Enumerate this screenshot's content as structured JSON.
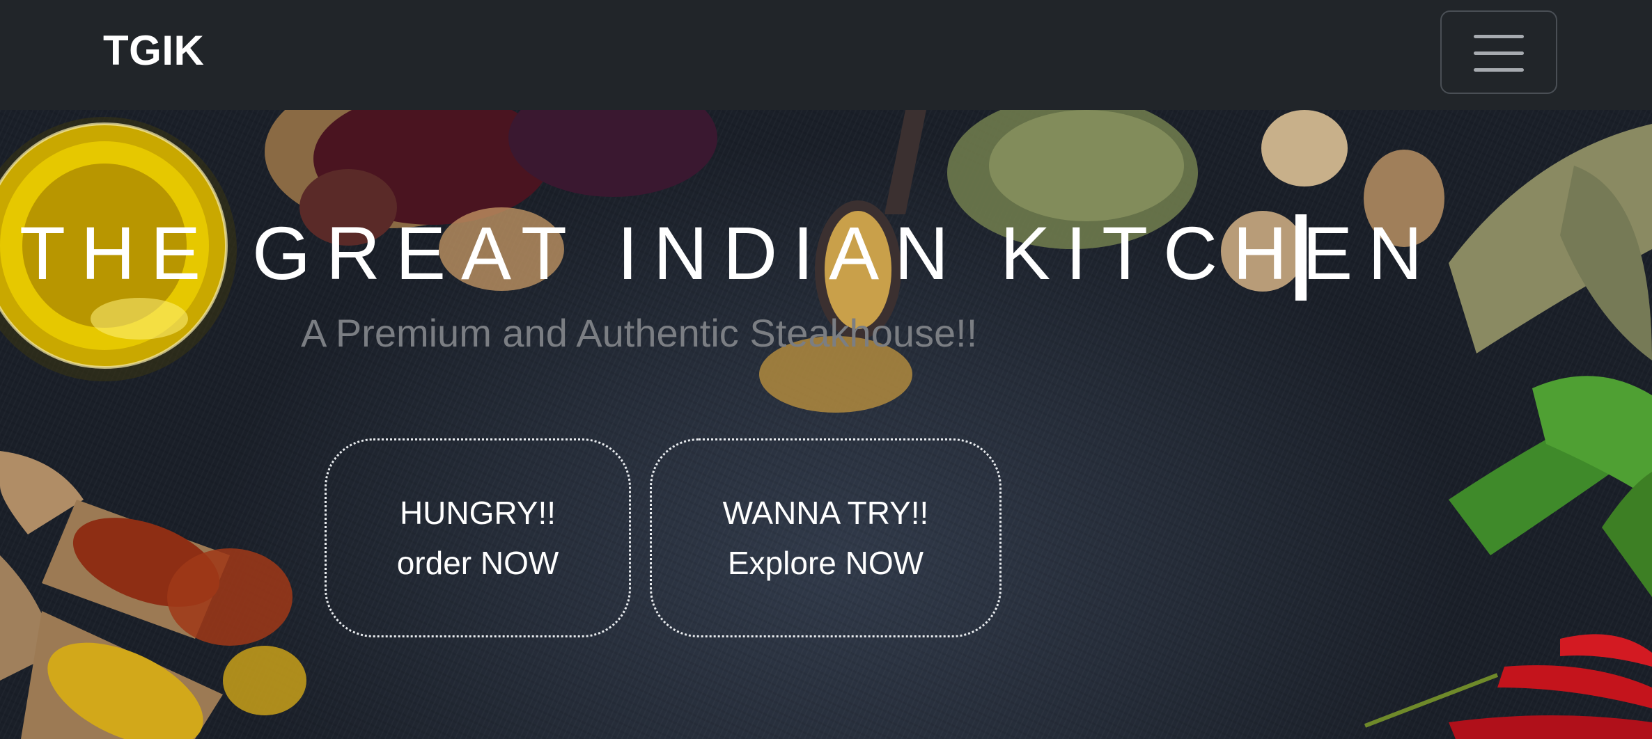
{
  "navbar": {
    "brand": "TGIK",
    "menu_icon": "hamburger-menu-icon"
  },
  "hero": {
    "title": "THE GREAT INDIAN KITCHEN",
    "subtitle": "A Premium and Authentic Steakhouse!!",
    "buttons": [
      {
        "line1": "HUNGRY!!",
        "line2": "order NOW"
      },
      {
        "line1": "WANNA TRY!!",
        "line2": "Explore NOW"
      }
    ]
  },
  "colors": {
    "navbar_bg": "#212529",
    "title": "#ffffff",
    "subtitle": "#7b7e83",
    "button_border": "#e9ecef"
  }
}
